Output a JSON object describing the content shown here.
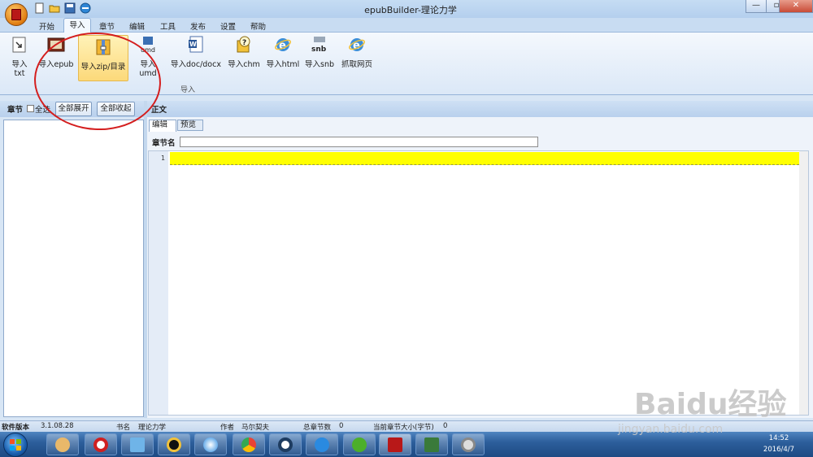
{
  "window": {
    "title": "epubBuilder-理论力学"
  },
  "menubar": {
    "items": [
      "开始",
      "导入",
      "章节",
      "编辑",
      "工具",
      "发布",
      "设置",
      "帮助"
    ],
    "active": "导入"
  },
  "ribbon": {
    "buttons": [
      "导入txt",
      "导入epub",
      "导入zip/目录",
      "导入umd",
      "导入doc/docx",
      "导入chm",
      "导入html",
      "导入snb",
      "抓取网页"
    ],
    "group_label": "导入",
    "snb_icon_text": "snb",
    "umd_icon_text": "umd"
  },
  "left_panel": {
    "title": "章节",
    "select_all": "全选",
    "expand_all": "全部展开",
    "collapse_all": "全部收起"
  },
  "right_panel": {
    "title": "正文",
    "tabs": [
      "编辑",
      "预览"
    ],
    "chapter_name_label": "章节名",
    "chapter_name_value": "",
    "line_number": "1"
  },
  "status_bar": {
    "version_label": "软件版本",
    "version": "3.1.08.28",
    "book_label": "书名",
    "book": "理论力学",
    "author_label": "作者",
    "author": "马尔契夫",
    "chapters_label": "总章节数",
    "chapters": "0",
    "chapter_size_label": "当前章节大小(字节)",
    "chapter_size": "0"
  },
  "taskbar": {
    "time": "14:52",
    "date": "2016/4/7"
  },
  "watermark": {
    "logo": "Baidu经验",
    "url": "jingyan.baidu.com"
  },
  "colors": {
    "accent": "#fcd97a",
    "highlight": "#ffff00",
    "annotation": "#d41e1e"
  }
}
